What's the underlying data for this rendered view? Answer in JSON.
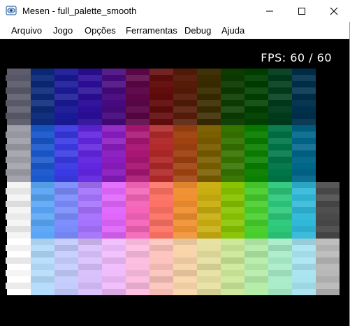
{
  "window": {
    "title": "Mesen - full_palette_smooth",
    "app_icon": "mesen-app-icon",
    "controls": [
      "minimize-icon",
      "maximize-icon",
      "close-icon"
    ]
  },
  "menu": {
    "items": [
      "Arquivo",
      "Jogo",
      "Opções",
      "Ferramentas",
      "Debug",
      "Ajuda"
    ]
  },
  "viewport": {
    "fps_text": "FPS: 60 / 60",
    "background": "#000000"
  },
  "palette": {
    "blocks": [
      [
        "#5c5c6c",
        "#0b2a7a",
        "#1a1a98",
        "#2c0e98",
        "#470a7e",
        "#5c0648",
        "#620c0c",
        "#561c08",
        "#3a2c00",
        "#0c3c00",
        "#004000",
        "#003c1c",
        "#00304c",
        "#000000",
        "#000000",
        "#000000"
      ],
      [
        "#a0a0aa",
        "#1a58cc",
        "#3a3ae4",
        "#6226e0",
        "#8a1cc0",
        "#a81674",
        "#b22a2a",
        "#a04210",
        "#7a5e00",
        "#367400",
        "#0a8000",
        "#007648",
        "#00668a",
        "#000000",
        "#000000",
        "#000000"
      ],
      [
        "#f4f4f4",
        "#5aa6f6",
        "#7a8cfc",
        "#a472fc",
        "#e066fc",
        "#f464b8",
        "#fc7264",
        "#f09030",
        "#caae10",
        "#88c400",
        "#48ce2c",
        "#2cc87a",
        "#30b8d8",
        "#4a4a4a",
        "#000000",
        "#000000"
      ],
      [
        "#ffffff",
        "#b4dcfc",
        "#c4ccfc",
        "#d8c0fc",
        "#f0bcfc",
        "#fcbce0",
        "#fcc4bc",
        "#f8d4a8",
        "#e6e0a0",
        "#cce898",
        "#b4eca8",
        "#a8ecc8",
        "#a8e4f0",
        "#b8b8b8",
        "#000000",
        "#000000"
      ]
    ]
  }
}
